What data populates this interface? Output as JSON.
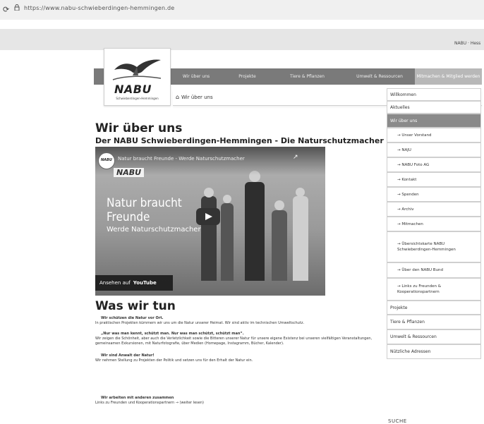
{
  "browser": {
    "url": "https://www.nabu-schwieberdingen-hemmingen.de"
  },
  "header": {
    "utility": "NABU · Hess",
    "logo_text": "NABU",
    "logo_sub": "Schwieberdingen-Hemmingen"
  },
  "nav": {
    "items": [
      {
        "label": "Wir über uns"
      },
      {
        "label": "Projekte"
      },
      {
        "label": "Tiere & Pflanzen"
      },
      {
        "label": "Umwelt & Ressourcen"
      },
      {
        "label": "Mitmachen & Mitglied werden"
      }
    ]
  },
  "breadcrumb": {
    "current": "Wir über uns"
  },
  "main": {
    "title": "Wir über uns",
    "subtitle": "Der NABU Schwieberdingen-Hemmingen - Die Naturschutzmacher",
    "video": {
      "channel": "NABU",
      "title": "Natur braucht Freunde - Werde Naturschutzmacher",
      "overlay_logo": "NABU",
      "claim_line1": "Natur braucht",
      "claim_line2": "Freunde",
      "claim_line3": "Werde Naturschutzmacher",
      "watch_label": "Ansehen auf",
      "watch_brand": "YouTube"
    },
    "section_title": "Was wir tun",
    "items": [
      {
        "lead": "Wir schützen die Natur vor Ort.",
        "text": "In praktischen Projekten kümmern wir uns um die Natur unserer Heimat. Wir sind aktiv im technischen Umweltschutz."
      },
      {
        "lead": "„Nur was man kennt, schützt man. Nur was man schützt, schützt man“.",
        "text": "Wir zeigen die Schönheit, aber auch die Verletzlichkeit sowie die Bitteren unserer Natur für unsere eigene Existenz bei unseren vielfältigen Veranstaltungen, gemeinsamen Exkursionen, mit Naturfotografie, über Medien (Homepage, Instagramm, Bücher, Kalender)."
      },
      {
        "lead": "Wir sind Anwalt der Natur!",
        "text": "Wir nehmen Stellung zu Projekten der Politik und setzen uns für den Erhalt der Natur ein."
      },
      {
        "lead": "Wir arbeiten mit anderen zusammen",
        "text": "Links zu Freunden und Kooperationspartnern → (weiter lesen)"
      }
    ]
  },
  "sidebar": {
    "items": [
      {
        "label": "Willkommen",
        "level": "top",
        "active": false
      },
      {
        "label": "Aktuelles",
        "level": "top",
        "active": false
      },
      {
        "label": "Wir über uns",
        "level": "top",
        "active": true
      },
      {
        "label": "→ Unser Vorstand",
        "level": "sub",
        "active": false
      },
      {
        "label": "→ NAJU",
        "level": "sub",
        "active": false
      },
      {
        "label": "→ NABU Foto AG",
        "level": "sub",
        "active": false
      },
      {
        "label": "→ Kontakt",
        "level": "sub",
        "active": false
      },
      {
        "label": "→ Spenden",
        "level": "sub",
        "active": false
      },
      {
        "label": "→ Archiv",
        "level": "sub",
        "active": false
      },
      {
        "label": "→ Mitmachen",
        "level": "sub",
        "active": false
      },
      {
        "label": "→ Übersichtskarte NABU Schwieberdingen-Hemmingen",
        "level": "sub",
        "active": false
      },
      {
        "label": "→ Über den NABU Bund",
        "level": "sub",
        "active": false
      },
      {
        "label": "→ Links zu Freunden & Kooperationspartnern",
        "level": "sub",
        "active": false
      },
      {
        "label": "Projekte",
        "level": "top",
        "active": false
      },
      {
        "label": "Tiere & Pflanzen",
        "level": "top",
        "active": false
      },
      {
        "label": "Umwelt & Ressourcen",
        "level": "top",
        "active": false
      },
      {
        "label": "Nützliche Adressen",
        "level": "top",
        "active": false
      }
    ],
    "search_label": "SUCHE"
  }
}
